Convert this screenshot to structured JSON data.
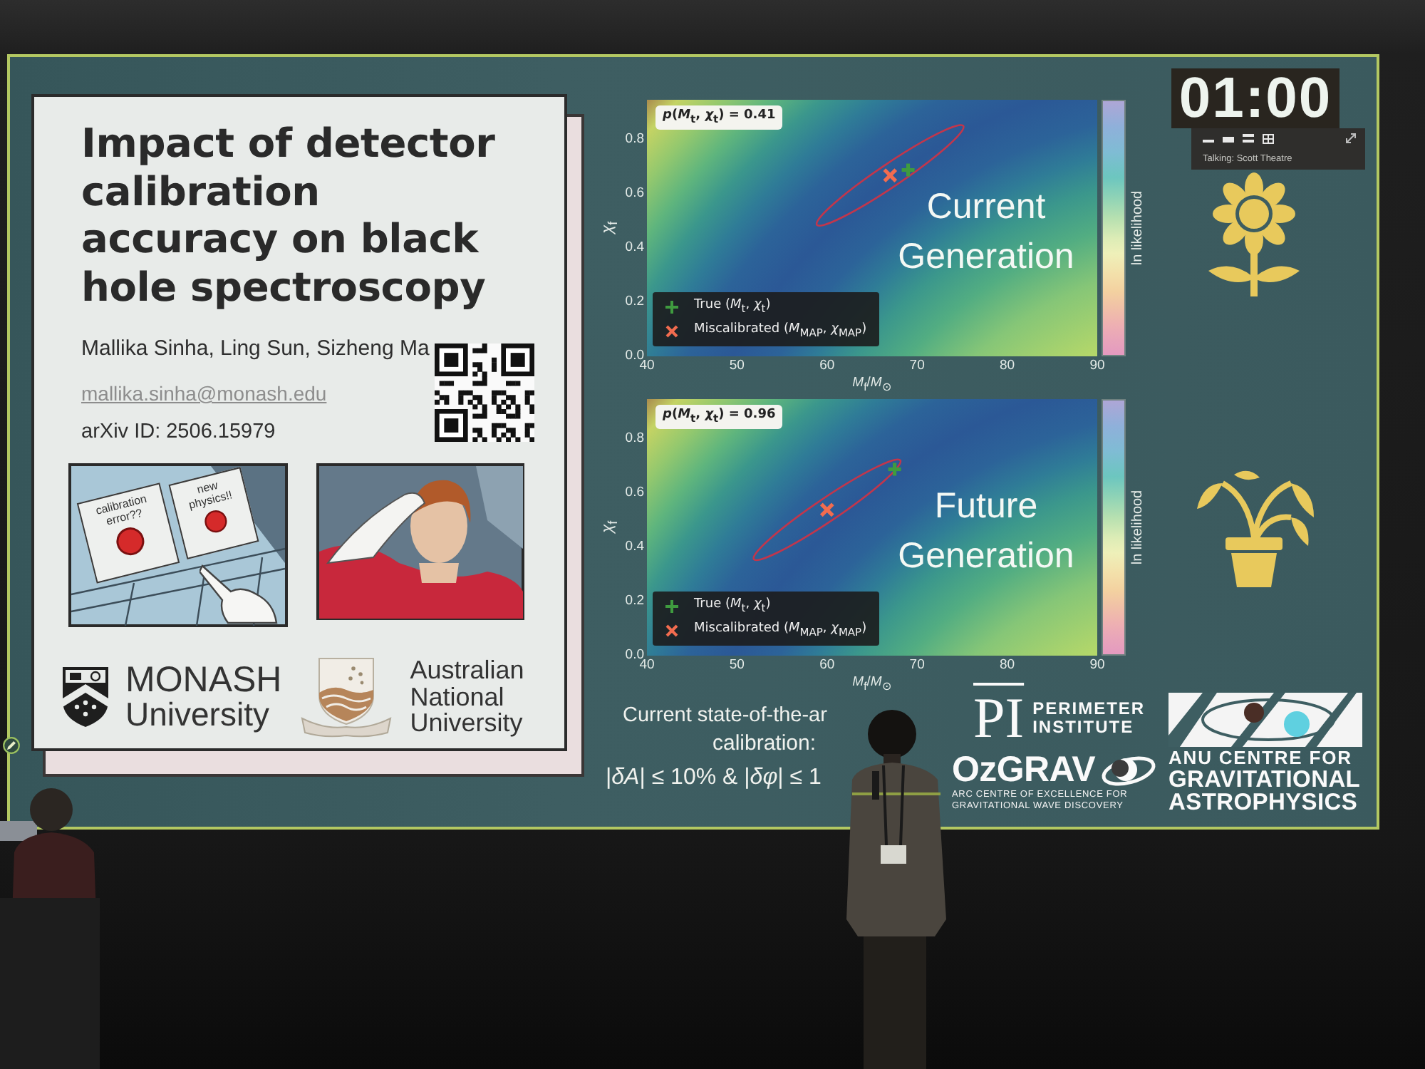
{
  "slide": {
    "poster": {
      "title": "Impact of detector calibration accuracy on black hole spectroscopy",
      "authors": "Mallika Sinha, Ling Sun, Sizheng Ma",
      "email": "mallika.sinha@monash.edu",
      "arxiv": "arXiv ID: 2506.15979",
      "meme_signs": [
        "calibration error??",
        "new physics!!"
      ],
      "monash_logo": {
        "name": "MONASH",
        "subtitle": "University"
      },
      "anu_logo": {
        "name": "Australian National University"
      }
    },
    "plots": [
      {
        "caption": "Current Generation",
        "colorbar_label": "ln likelihood",
        "chart_data": {
          "type": "scatter",
          "xlabel": "*M*$_{f}$/*M*$_{⊙}$",
          "ylabel": "*χ*$_{f}$",
          "x": [
            67,
            69
          ],
          "series": [
            {
              "name": "True (*M*$_{t}$, *χ*$_{t}$)",
              "color": "#3f9b3f",
              "values": [
                null,
                0.69
              ]
            },
            {
              "name": "Miscalibrated (*M*$_{MAP}$, *χ*$_{MAP}$)",
              "color": "#f26c4f",
              "values": [
                0.67,
                null
              ]
            }
          ],
          "xlim": [
            40,
            90
          ],
          "ylim": [
            0,
            0.95
          ],
          "xticks": [
            40,
            50,
            60,
            70,
            80,
            90
          ],
          "yticks": [
            {
              "value": 0,
              "label": "0.0"
            },
            0.2,
            0.4,
            0.6,
            0.8
          ],
          "legend": "lower left",
          "annotations": [
            {
              "text": "*p*(*M*$_{t}$, *χ*$_{t}$) = 0.41"
            }
          ]
        }
      },
      {
        "caption": "Future Generation",
        "colorbar_label": "ln likelihood",
        "chart_data": {
          "type": "scatter",
          "xlabel": "*M*$_{f}$/*M*$_{⊙}$",
          "ylabel": "*χ*$_{f}$",
          "x": [
            60,
            67.5
          ],
          "series": [
            {
              "name": "True (*M*$_{t}$, *χ*$_{t}$)",
              "color": "#3f9b3f",
              "values": [
                null,
                0.69
              ]
            },
            {
              "name": "Miscalibrated (*M*$_{MAP}$, *χ*$_{MAP}$)",
              "color": "#f26c4f",
              "values": [
                0.54,
                null
              ]
            }
          ],
          "xlim": [
            40,
            90
          ],
          "ylim": [
            0,
            0.95
          ],
          "xticks": [
            40,
            50,
            60,
            70,
            80,
            90
          ],
          "yticks": [
            {
              "value": 0,
              "label": "0.0"
            },
            0.2,
            0.4,
            0.6,
            0.8
          ],
          "legend": "lower left",
          "annotations": [
            {
              "text": "*p*(*M*$_{t}$, *χ*$_{t}$) = 0.96"
            }
          ]
        }
      }
    ],
    "timer": {
      "time": "01:00",
      "status": "Talking: Scott Theatre"
    },
    "note": [
      "Current state-of-the-ar",
      "calibration:",
      "|*δA*| ≤ 10% & |*δφ*| ≤ 1"
    ],
    "perimeter_logo": {
      "mark": "PI",
      "lines": [
        "PERIMETER",
        "INSTITUTE"
      ]
    },
    "ozgrav_logo": {
      "name": "OzGRAV",
      "tagline": "ARC CENTRE OF EXCELLENCE FOR GRAVITATIONAL WAVE DISCOVERY"
    },
    "anu_cga_logo": {
      "lines": [
        "ANU CENTRE FOR",
        "GRAVITATIONAL",
        "ASTROPHYSICS"
      ]
    }
  }
}
